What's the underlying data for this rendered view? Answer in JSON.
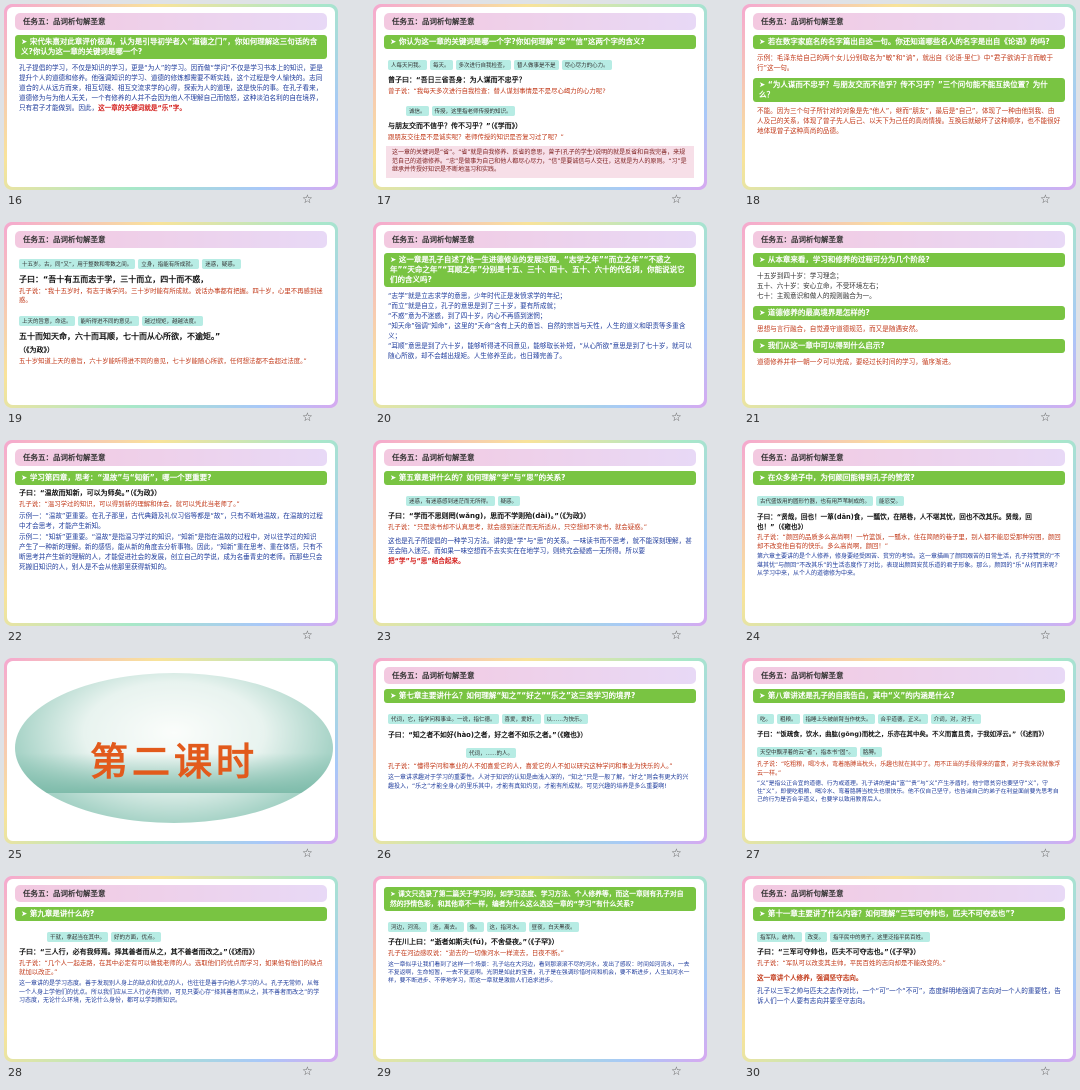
{
  "header": "任务五：品词析句解圣意",
  "slides": [
    {
      "num": "16",
      "q": "宋代朱熹对此章评价极高，认为是引导初学者入“道德之门”，你如何理解这三句话的含义?你认为这一章的关键词是哪一个?",
      "body": "孔子提倡的学习，不仅是知识的学习，更是“为人”的学习。因而做“学问”不仅是学习书本上的知识，更是提升个人的道德和修养。他强调知识的学习、道德的修炼都需要不断实践，这个过程是令人愉快的。志同道合的人从远方而来，相互切磋、相互交流求学的心得，探索为人的道理，这是快乐的事。在孔子看来，道德修为与为他人无关，一个有修养的人并不会因为他人不理解自己而恼怒，这种淡泊名利的自在境界，只有君子才能做到。因此，",
      "hl": "这一章的关键词就是“乐”字。"
    },
    {
      "num": "17",
      "q": "你认为这一章的关键词是哪一个字?你如何理解“忠”“信”这两个字的含义?",
      "tags": [
        "人每天问我。",
        "每天。",
        "多次进行自我检查，",
        "替人做事是不是",
        "尽心尽力的心力。"
      ],
      "quote": "曾子曰：“吾日三省吾身：为人谋而不忠乎？",
      "cmt": "曾子说：“我每天多次进行自我检查：替人谋划事情是不是尽心竭力的心力呢?",
      "tags2": [
        "诚信。",
        "传授，这里指老师传授的知识。"
      ],
      "quote2": "与朋友交而不信乎？传不习乎？”（《学而》）",
      "cmt2": "跟朋友交往是不是诚实呢？老师传授的知识是否复习过了呢？”",
      "pink": "这一章的关键词是“省”。“省”就是自我修养、反省的意思，曾子(孔子的学生)说明的就是反省和自我完善，来规范自己的道德修养。“忠”是做事为自己和他人都尽心尽力，“信”是要诚信与人交往，这就是为人的原则。“习”是继承并传授好知识是不断地温习和实践。"
    },
    {
      "num": "18",
      "q": "若在数字家庭名的名字篇出自这一句。你还知道哪些名人的名字是出自《论语》的吗?",
      "body": "示例：毛泽东给自己的两个女儿分别取名为“敏”和“讷”，就出自《论语·里仁》中“君子欲讷于言而敏于行”这一句。",
      "q2": "“为人谋而不忠乎？与朋友交而不信乎？传不习乎？”三个问句能不能互换位置？为什么？",
      "body2": "不能。因为三个句子所针对的对象是先“他人”，继而“朋友”，最后是“自己”，体现了一种由他到我、由人及己的关系，体现了曾子先人后己、以天下为己任的高尚情操。互换后就破坏了这种顺序，也不能很好地体现曾子这种高尚的品德。"
    },
    {
      "num": "19",
      "tags": [
        "十五岁。古，同“又”，用于整数和零数之间。",
        "立身，指能有所成就。",
        "迷惑，疑惑。"
      ],
      "quote": "子曰：“吾十有五而志于学，三十而立，四十而不惑，",
      "cmt": "孔子说：“我十五岁时，有志于做学问。三十岁时能有所成就。说话办事都有把握。四十岁，心里不再感到迷惑。",
      "tags2": [
        "上天的旨意，命运。",
        "能听得进不同的意见。",
        "越过规矩，越越法度。"
      ],
      "quote2": "五十而知天命，六十而耳顺，七十而从心所欲，不逾矩。”",
      "src": "（《为政》）",
      "cmt2": "五十岁知道上天的意旨，六十岁能听得进不同的意见，七十岁能随心所欲，任何想法都不会超过法度。”"
    },
    {
      "num": "20",
      "q": "这一章是孔子自述了他一生进德修业的发展过程。“志学之年”“而立之年”“不惑之年”“天命之年”“耳顺之年”分别是十五、三十、四十、五十、六十的代名词，你能说说它们的含义吗?",
      "lines": [
        "“志学”就是立志求学的意思，少年时代正是发愤求学的年纪；",
        "“而立”就是自立，孔子的意思是到了三十岁，要有所成就；",
        "“不惑”意为不迷惑，到了四十岁，内心不再感到迷惘；",
        "“知天命”强调“知命”，这里的“天命”含有上天的意旨、自然的宗旨与天性，人生的道义和职责等多重含义；",
        "“耳顺”意思是到了六十岁，能够听得进不同意见，能够取长补短，“从心所欲”意思是到了七十岁，就可以随心所欲，却不会越出规矩。人生修养至此，也日臻完善了。"
      ]
    },
    {
      "num": "21",
      "q": "从本章来看，学习和修养的过程可分为几个阶段?",
      "lines": [
        "十五岁到四十岁：学习理念；",
        "五十、六十岁：安心立命，不受环境左右；",
        "七十：主观意识和做人的规则融合为一。"
      ],
      "q2": "道德修养的最高境界是怎样的?",
      "body2": "思想与言行融合，自觉遵守道德规范，而又是随遇安然。",
      "q3": "我们从这一章中可以得到什么启示?",
      "body3": "道德修养并非一朝一夕可以完成，要经过长时间的学习，循序渐进。"
    },
    {
      "num": "22",
      "q": "学习第四章，思考：“温故”与“知新”，哪一个更重要?",
      "quote": "子曰：“温故而知新，可以为师矣。”（《为政》）",
      "cmt": "孔子说：“温习学过的知识，可以得到新的理解和体会，就可以凭此当老师了。”",
      "body": "示例一：“温故”更重要。在孔子那里，古代典籍及礼仪习俗等都是“故”，只有不断地温故，在温故的过程中才会思考，才能产生新知。",
      "body2": "示例二：“知新”更重要。“温故”是指温习学过的知识，“知新”是指在温故的过程中，对以往学过的知识产生了一种新的理解。新的感悟，能从新的角度去分析事物。因此，“知新”重在思考、重在体悟，只有不断思考并产生新的理解的人，才能促进社会的发展，创立自己的学说，成为名垂青史的老师。而那些只会死搬旧知识的人，别人是不会从他那里获得新知的。"
    },
    {
      "num": "23",
      "q": "第五章是讲什么的？如何理解“学”与“思”的关系?",
      "tags": [
        "迷惑，有迷惑感到迷茫而无所得。",
        "疑惑。"
      ],
      "quote": "子曰：“学而不思则罔(wǎng)，思而不学则殆(dài)。”（《为政》）",
      "cmt": "孔子说：“只是读书却不认真思考，就会感到迷茫而无所适从，只空想却不读书，就会疑惑。”",
      "body": "这也是孔子所提倡的一种学习方法。讲的是“学”与“思”的关系。一味读书而不思考，就不能深刻理解，甚至会陷入迷茫。而如果一味空想而不去实实在在地学习，则终究会疑惑一无所得。所以要",
      "hl": "把“学”与“思”结合起来。"
    },
    {
      "num": "24",
      "q": "在众多弟子中，为何颜回能得到孔子的赞赏?",
      "tags": [
        "古代盛饭用的圆形竹器，也有用芦苇制成的。",
        "能忍受。"
      ],
      "quote": "子曰：“贤哉，回也！一箪(dān)食，一瓢饮，在陋巷，人不堪其忧，回也不改其乐。贤哉，回也！”（《雍也》）",
      "cmt": "孔子说：“颜回的品质多么高尚啊！一竹篮饭，一瓢水，住在简陋的巷子里，别人都不能忍受那种穷困，颜回却不改变他自有的快乐。多么高尚啊，颜回！”",
      "body": "第六章主要讲的是个人修养，修身要经受困苦、贫穷的考验。这一章描画了颜回艰苦的日常生活，孔子持赞赏的“不堪其忧”与颜回“不改其乐”的生活态度作了对比，表现出颜回安贫乐道的君子形象。那么，颜回的“乐”从何而来呢?从学习中来，从个人的道德修为中来。"
    },
    {
      "num": "25",
      "title": "第二课时"
    },
    {
      "num": "26",
      "q": "第七章主要讲什么？如何理解“知之”“好之”“乐之”这三类学习的境界?",
      "tags": [
        "代词，它，指学问和事业。一说，指仁德。",
        "喜爱，爱好。",
        "以……为快乐。"
      ],
      "quote": "子曰：“知之者不如好(hào)之者，好之者不如乐之者。”（《雍也》）",
      "tags2": [
        "代词，……的人。"
      ],
      "cmt": "孔子说：“懂得学问和事业的人不如喜爱它的人，喜爱它的人不如以研究这种学问和事业为快乐的人。”",
      "body": "这一章讲求趣对于学习的重要性。人对于知识的认知是由浅入深的，“知之”只是一般了解，“好之”则会有更大的兴趣投入，“乐之”才能全身心的里乐其中，才能有真知灼见，才能有所成就。可见兴趣的培养是多么重要啊!"
    },
    {
      "num": "27",
      "q": "第八章讲述是孔子的自我告白，其中“义”的内涵是什么?",
      "tags": [
        "吃。",
        "粗粮。",
        "指睡上头被前臂当作枕头。",
        "合乎道德，正义。",
        "介词，对，对于。"
      ],
      "quote": "子曰：“饭疏食，饮水，曲肱(gōng)而枕之，乐亦在其中矣。不义而富且贵，于我如浮云。”（《述而》）",
      "tags2": [
        "天空中飘浮着的云“者”，指本书“固”。",
        "胳膊。"
      ],
      "cmt": "孔子说：“吃粗粮，喝冷水，弯着胳膊当枕头，乐趣也就在其中了。用不正当的手段得来的富贵，对于我来说就像浮云一样。”",
      "body": "“义”是指公正合宜的道德、行为或道理。孔子讲的是由“富”“贵”与“义”产生矛盾时，他宁愿贫穷也要坚守“义”，守住“义”，即便吃粗粮、喝冷水、弯着胳膊当枕头也很快乐。他不仅自己坚守，也告诫自己的弟子在利益面前要先思考自己的行为是否合乎道义，也要学以致用教育后人。"
    },
    {
      "num": "28",
      "q": "第九章是讲什么的?",
      "tags": [
        "干就，拿起当在其中。",
        "好的方面，优点。"
      ],
      "quote": "子曰：“三人行，必有我师焉。择其善者而从之，其不善者而改之。”（《述而》）",
      "cmt": "孔子说：“几个人一起走路，在其中必定有可以做我老师的人。选取他们的优点而学习，如果他有他们的缺点就加以改正。”",
      "body": "这一章讲的是学习态度。善于发现别人身上的缺点和优点的人，也往往是善于向他人学习的人。孔子无常师，从每一个人身上学他们的优点。所以我们应从三人行必有我师，可见只要心存“择其善者而从之，其不善者而改之”的学习态度，无论什么环境，无论什么身份，都可以学到新知识。"
    },
    {
      "num": "29",
      "q": "课文只选录了第二篇关于学习的，如学习态度、学习方法、个人修养等，而这一章则有孔子对自然的抒情色彩，和其他章不一样，编者为什么这么选这一章的“学习”有什么关系?",
      "tags": [
        "河边，河流。",
        "逝，离去。",
        "像。",
        "这，指河水。",
        "昼夜，白天黑夜。"
      ],
      "quote": "子在川上曰：“逝者如斯夫(fú)，不舍昼夜。”（《子罕》）",
      "cmt": "孔子在河边感叹说：“逝去的一切像河水一样流去，日夜不断。”",
      "body": "这一章似乎让我们看到了这样一个场景：孔子站在大河边，看到那滚滚不尽的河水，发出了感叹：时间如河流水，一去不复返啊，生命短暂，一去不复返啊。光阴是如此的宝贵，孔子是在强调珍惜时间和机会，要不断进步，人生如河水一样，要不断进步、不停地学习，而这一章就是激励人们追求进步。"
    },
    {
      "num": "30",
      "q": "第十一章主要讲了什么内容？如何理解“三军可夺帅也，匹夫不可夺志也”?",
      "tags": [
        "指军队，统帅。",
        "改变。",
        "指平民中的男子，这里泛指平民百姓。"
      ],
      "quote": "子曰：“三军可夺帅也，匹夫不可夺志也。”（《子罕》）",
      "cmt": "孔子说：“军队可以改变其主帅，平民百姓的志向却是不能改变的。”",
      "body": "这一章讲个人修养，强调坚守志向。",
      "body2": "孔子以三军之帅与匹夫之志作对比，一个“可”一个“不可”，态度鲜明地强调了志向对一个人的重要性，告诉人们一个人要有志向并要坚守志向。"
    }
  ]
}
